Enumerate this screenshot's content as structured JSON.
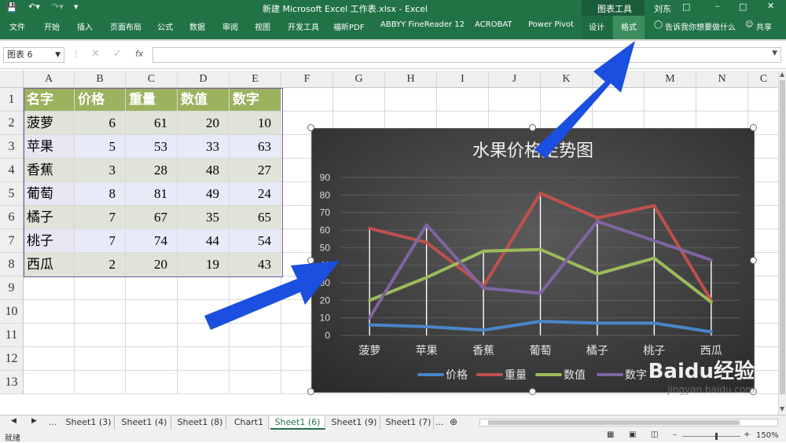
{
  "titlebar": {
    "title": "新建 Microsoft Excel 工作表.xlsx  -  Excel",
    "context_tool": "图表工具",
    "user": "刘东"
  },
  "ribbon": {
    "tabs": [
      "文件",
      "开始",
      "插入",
      "页面布局",
      "公式",
      "数据",
      "审阅",
      "视图",
      "开发工具",
      "福昕PDF",
      "ABBYY FineReader 12",
      "ACROBAT",
      "Power Pivot",
      "设计",
      "格式"
    ],
    "active_tab": "格式",
    "tell_me": "告诉我你想要做什么",
    "share": "共享"
  },
  "formula_bar": {
    "name_box": "图表 6",
    "fx": "fx",
    "value": ""
  },
  "columns": [
    "A",
    "B",
    "C",
    "D",
    "E",
    "F",
    "G",
    "H",
    "I",
    "J",
    "K",
    "L",
    "M",
    "N",
    "C"
  ],
  "rows": [
    "1",
    "2",
    "3",
    "4",
    "5",
    "6",
    "7",
    "8",
    "9",
    "10",
    "11",
    "12",
    "13"
  ],
  "table": {
    "headers": [
      "名字",
      "价格",
      "重量",
      "数值",
      "数字"
    ],
    "rows": [
      [
        "菠萝",
        "6",
        "61",
        "20",
        "10"
      ],
      [
        "苹果",
        "5",
        "53",
        "33",
        "63"
      ],
      [
        "香蕉",
        "3",
        "28",
        "48",
        "27"
      ],
      [
        "葡萄",
        "8",
        "81",
        "49",
        "24"
      ],
      [
        "橘子",
        "7",
        "67",
        "35",
        "65"
      ],
      [
        "桃子",
        "7",
        "74",
        "44",
        "54"
      ],
      [
        "西瓜",
        "2",
        "20",
        "19",
        "43"
      ]
    ]
  },
  "chart_data": {
    "type": "line",
    "title": "水果价格走势图",
    "categories": [
      "菠萝",
      "苹果",
      "香蕉",
      "葡萄",
      "橘子",
      "桃子",
      "西瓜"
    ],
    "series": [
      {
        "name": "价格",
        "values": [
          6,
          5,
          3,
          8,
          7,
          7,
          2
        ],
        "color": "#4a86c8"
      },
      {
        "name": "重量",
        "values": [
          61,
          53,
          28,
          81,
          67,
          74,
          20
        ],
        "color": "#c0504d"
      },
      {
        "name": "数值",
        "values": [
          20,
          33,
          48,
          49,
          35,
          44,
          19
        ],
        "color": "#9bbb59"
      },
      {
        "name": "数字",
        "values": [
          10,
          63,
          27,
          24,
          65,
          54,
          43
        ],
        "color": "#8064a2"
      }
    ],
    "yticks": [
      "0",
      "10",
      "20",
      "30",
      "40",
      "50",
      "60",
      "70",
      "80",
      "90"
    ],
    "ylim": [
      0,
      90
    ],
    "grid": true,
    "legend": "bottom"
  },
  "sheet_tabs": {
    "items": [
      "Sheet1 (3)",
      "Sheet1 (4)",
      "Sheet1 (8)",
      "Chart1",
      "Sheet1 (6)",
      "Sheet1 (9)",
      "Sheet1 (7)"
    ],
    "active": "Sheet1 (6)",
    "more": "...",
    "more2": "..."
  },
  "status_bar": {
    "mode": "就绪",
    "zoom": "150%"
  },
  "watermark": {
    "text": "Baidu经验",
    "url": "jingyan.baidu.com"
  },
  "colors": {
    "excel_green": "#217346",
    "arrow_blue": "#1b4fe0"
  }
}
